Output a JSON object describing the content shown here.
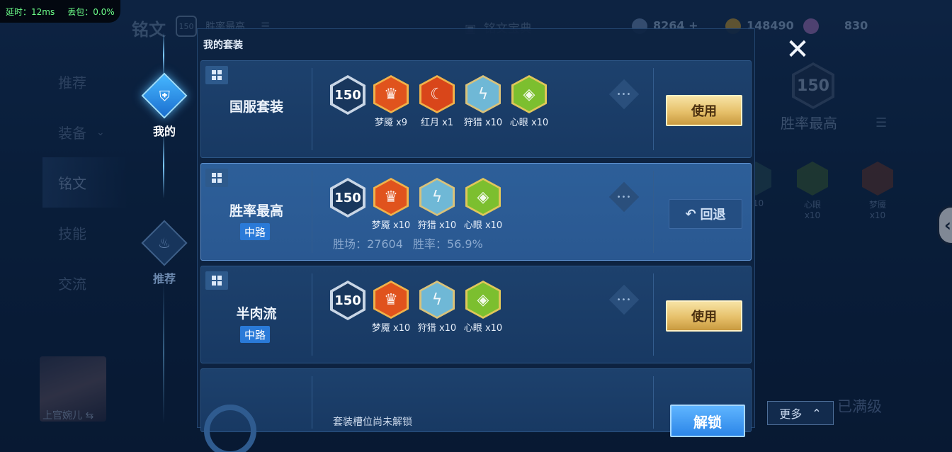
{
  "net": {
    "latency": "延时：12ms",
    "loss": "丢包：0.0%"
  },
  "topbar": {
    "title": "铭文",
    "level": "150",
    "current_suite": "胜率最高",
    "codex": "铭文宝典",
    "currency": [
      {
        "icon": "gem-icon",
        "value": "8264",
        "color": "#7fa8d8"
      },
      {
        "icon": "gold-coin-icon",
        "value": "148490",
        "color": "#d8b14a"
      },
      {
        "icon": "diamond-icon",
        "value": "830",
        "color": "#b58be0"
      }
    ]
  },
  "left_nav": [
    "推荐",
    "装备",
    "铭文",
    "技能",
    "交流"
  ],
  "left_nav_active": "铭文",
  "hero": {
    "name": "上官婉儿"
  },
  "tabs": [
    {
      "label": "我的",
      "icon": "armor-icon",
      "active": true
    },
    {
      "label": "推荐",
      "icon": "flame-icon",
      "active": false
    }
  ],
  "panel": {
    "title": "我的套装",
    "cards": [
      {
        "name": "国服套装",
        "tag": "",
        "level": "150",
        "runes": [
          {
            "label": "梦魇",
            "count": "x9",
            "icon": "nightmare-rune-icon",
            "color": "#e0531d"
          },
          {
            "label": "红月",
            "count": "x1",
            "icon": "red-moon-rune-icon",
            "color": "#d9461a"
          },
          {
            "label": "狩猎",
            "count": "x10",
            "icon": "hunt-rune-icon",
            "color": "#6fb8d6"
          },
          {
            "label": "心眼",
            "count": "x10",
            "icon": "mind-eye-rune-icon",
            "color": "#7cbf2f"
          }
        ],
        "action": "使用",
        "selected": false
      },
      {
        "name": "胜率最高",
        "tag": "中路",
        "level": "150",
        "runes": [
          {
            "label": "梦魇",
            "count": "x10",
            "icon": "nightmare-rune-icon",
            "color": "#e0531d"
          },
          {
            "label": "狩猎",
            "count": "x10",
            "icon": "hunt-rune-icon",
            "color": "#6fb8d6"
          },
          {
            "label": "心眼",
            "count": "x10",
            "icon": "mind-eye-rune-icon",
            "color": "#7cbf2f"
          }
        ],
        "stats": {
          "games": "胜场：27604",
          "winrate": "胜率：56.9%"
        },
        "action": "回退",
        "selected": true
      },
      {
        "name": "半肉流",
        "tag": "中路",
        "level": "150",
        "runes": [
          {
            "label": "梦魇",
            "count": "x10",
            "icon": "nightmare-rune-icon",
            "color": "#e0531d"
          },
          {
            "label": "狩猎",
            "count": "x10",
            "icon": "hunt-rune-icon",
            "color": "#6fb8d6"
          },
          {
            "label": "心眼",
            "count": "x10",
            "icon": "mind-eye-rune-icon",
            "color": "#7cbf2f"
          }
        ],
        "action": "使用",
        "selected": false
      },
      {
        "locked_text": "套装槽位尚未解锁",
        "action": "解锁"
      }
    ]
  },
  "right": {
    "level": "150",
    "suite_name": "胜率最高",
    "runes": [
      {
        "label": "x10"
      },
      {
        "label": "心眼x10"
      },
      {
        "label": "梦魇x10"
      }
    ],
    "more": "更多",
    "maxed": "已满级"
  }
}
